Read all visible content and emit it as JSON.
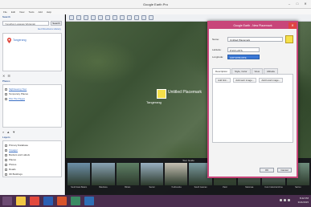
{
  "window": {
    "title": "Google Earth Pro",
    "controls": [
      "–",
      "□",
      "✕"
    ]
  },
  "menu": [
    "File",
    "Edit",
    "View",
    "Tools",
    "Add",
    "Help"
  ],
  "sidebar": {
    "search_header": "Search",
    "search_value": "Yonathan Lapasas Wulanjati",
    "search_button": "Search",
    "links": "Get Directions  History",
    "result": "Tangerang",
    "places_header": "Places",
    "places_items": [
      {
        "label": "Sightseeing Tour",
        "link": true
      },
      {
        "label": "Temporary Places",
        "link": false
      },
      {
        "label": "Plot Tile Pages",
        "link": true
      }
    ],
    "layers_header": "Layers",
    "layers_items": [
      "Primary Database",
      "Voyager",
      "Borders and Labels",
      "Places",
      "Photos",
      "Roads",
      "3D Buildings"
    ]
  },
  "map": {
    "placemark_label": "Untitled Placemark",
    "place_label": "Tangerang"
  },
  "tour": {
    "title": "Tour Guide",
    "thumbs": [
      {
        "label": "South East Batam",
        "color": "#6d8fa8"
      },
      {
        "label": "Batuhara",
        "color": "#8aa3b5"
      },
      {
        "label": "Bintan",
        "color": "#5f7f65"
      },
      {
        "label": "Sentul",
        "color": "#9ab0c2"
      },
      {
        "label": "Yudimunda",
        "color": "#c5c0b3"
      },
      {
        "label": "South Gaonan",
        "color": "#7b9aa0"
      },
      {
        "label": "Pasir",
        "color": "#5a6b4a"
      },
      {
        "label": "Nalomaa",
        "color": "#8e9a9f"
      },
      {
        "label": "Curo Industrial Zone",
        "color": "#a7b8c6"
      },
      {
        "label": "Sarmo",
        "color": "#6f8d7d"
      }
    ]
  },
  "dialog": {
    "title": "Google Earth - New Placemark",
    "name_label": "Name:",
    "name_value": "Untitled Placemark",
    "latitude_label": "Latitude:",
    "latitude_value": "6°21'1.20\"S",
    "longitude_label": "Longitude:",
    "longitude_value": "106°34'56.09\"E",
    "tabs": [
      "Description",
      "Style, Color",
      "View",
      "Altitude"
    ],
    "format_buttons": [
      "Add link...",
      "Add web image...",
      "Add local image..."
    ],
    "ok": "OK",
    "cancel": "Cancel"
  },
  "taskbar": {
    "apps": [
      {
        "name": "start-button",
        "color": "#6d4b73"
      },
      {
        "name": "explorer-app",
        "color": "#f2c744"
      },
      {
        "name": "chrome-app",
        "color": "#e2483d"
      },
      {
        "name": "word-app",
        "color": "#2b5fb3"
      },
      {
        "name": "powerpoint-app",
        "color": "#d8542c"
      },
      {
        "name": "media-app",
        "color": "#3a8a63"
      },
      {
        "name": "earth-app",
        "color": "#2e6fb5"
      }
    ],
    "time": "8:42 PM",
    "date": "3/24/2015"
  },
  "colors": {
    "accent": "#c8467a",
    "taskbar": "#4a2d4e",
    "selection": "#3a78d6"
  }
}
